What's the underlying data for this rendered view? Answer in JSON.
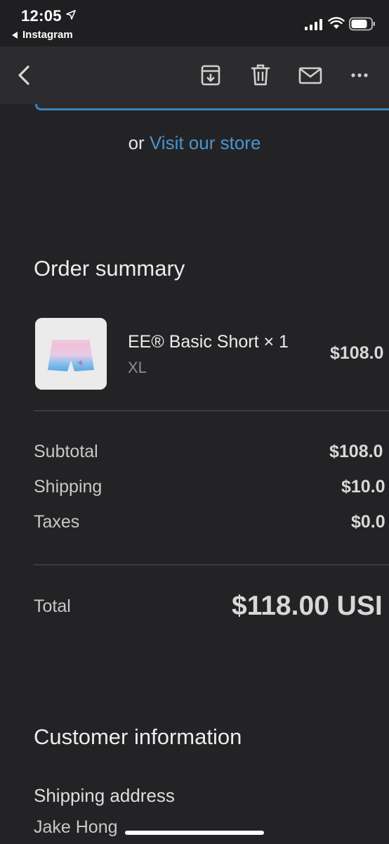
{
  "status_bar": {
    "time": "12:05",
    "back_app_label": "Instagram"
  },
  "toolbar": {
    "icons": [
      "back-chevron-icon",
      "archive-icon",
      "trash-icon",
      "mail-icon",
      "more-icon"
    ]
  },
  "store": {
    "visit_prefix": "or",
    "visit_link": "Visit our store"
  },
  "order_summary": {
    "title": "Order summary",
    "item": {
      "name": "EE® Basic Short × 1",
      "variant": "XL",
      "price": "$108.0"
    },
    "subtotal_label": "Subtotal",
    "subtotal_value": "$108.0",
    "shipping_label": "Shipping",
    "shipping_value": "$10.0",
    "taxes_label": "Taxes",
    "taxes_value": "$0.0",
    "total_label": "Total",
    "total_value": "$118.00 USI"
  },
  "customer_information": {
    "title": "Customer information",
    "shipping_address_label": "Shipping address",
    "name": "Jake Hong"
  },
  "colors": {
    "background": "#232325",
    "toolbar": "#2c2c2e",
    "link": "#4a94d0"
  }
}
